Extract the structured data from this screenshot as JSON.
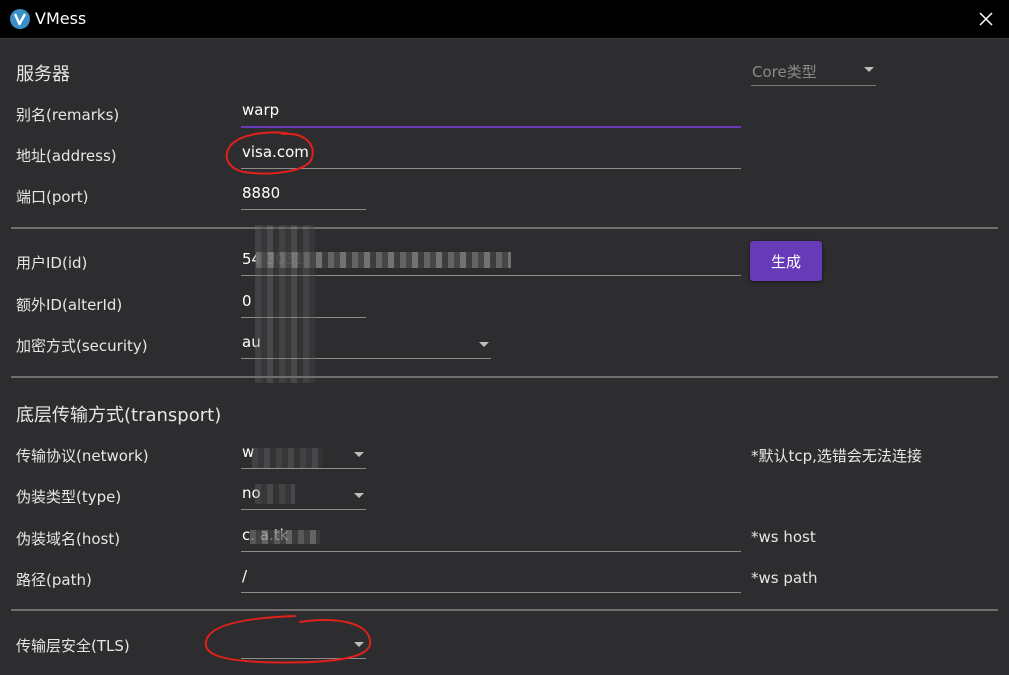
{
  "window": {
    "title": "VMess"
  },
  "server": {
    "section_title": "服务器",
    "core_type_placeholder": "Core类型",
    "remarks_label": "别名(remarks)",
    "remarks_value": "warp",
    "address_label": "地址(address)",
    "address_value": "visa.com",
    "port_label": "端口(port)",
    "port_value": "8880"
  },
  "user": {
    "id_label": "用户ID(id)",
    "id_value": "54                                    3031",
    "generate_label": "生成",
    "alter_id_label": "额外ID(alterId)",
    "alter_id_value": "0",
    "security_label": "加密方式(security)",
    "security_value": "au"
  },
  "transport": {
    "section_title": "底层传输方式(transport)",
    "network_label": "传输协议(network)",
    "network_value": "w",
    "network_note": "*默认tcp,选错会无法连接",
    "type_label": "伪装类型(type)",
    "type_value": "no",
    "host_label": "伪装域名(host)",
    "host_value": "c.            a.tk",
    "host_note": "*ws host",
    "path_label": "路径(path)",
    "path_value": "/",
    "path_note": "*ws path"
  },
  "tls": {
    "label": "传输层安全(TLS)",
    "value": ""
  },
  "colors": {
    "accent": "#673ab7",
    "annotation": "#e0201a",
    "background": "#2d2d30"
  },
  "icons": [
    "app-logo-icon",
    "close-icon",
    "dropdown-arrow-icon"
  ]
}
